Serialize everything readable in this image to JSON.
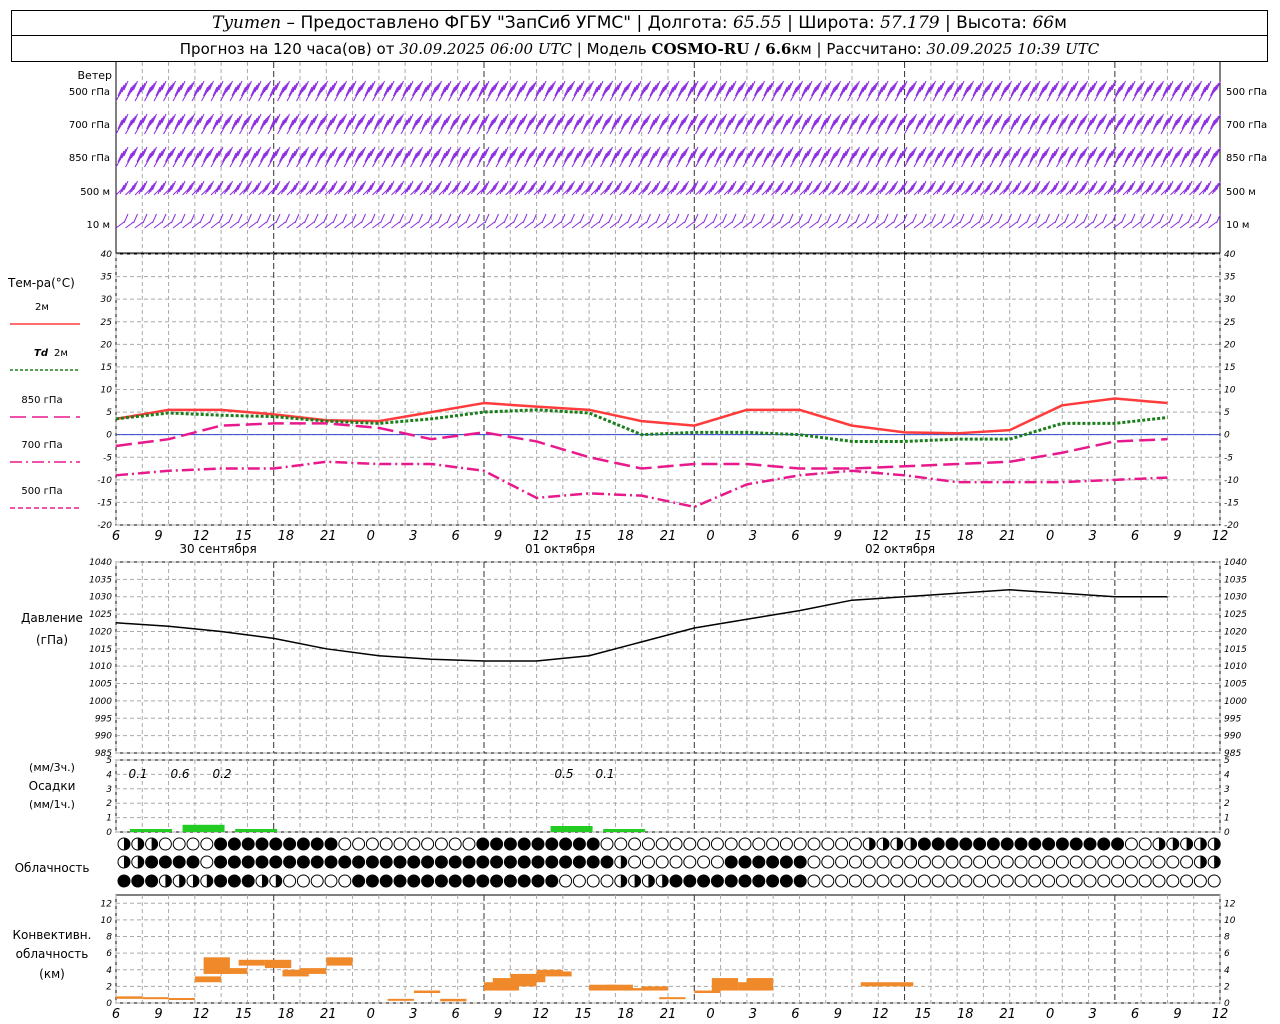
{
  "header": {
    "city": "Tyumen",
    "dash": " – ",
    "provider": "Предоставлено ФГБУ \"ЗапСиб УГМС\"",
    "lon_label": "Долгота: ",
    "lon": "65.55",
    "lat_label": "Широта: ",
    "lat": "57.179",
    "alt_label": "Высота: ",
    "alt": "66",
    "alt_unit": "м",
    "sep": " | ",
    "forecast_label": "Прогноз на 120 часа(ов) от ",
    "forecast_from": "30.09.2025 06:00 UTC",
    "model_label": "Модель ",
    "model": "COSMO-RU / 6.6",
    "model_unit": "км",
    "calc_label": "Рассчитано: ",
    "calc_time": "30.09.2025 10:39 UTC"
  },
  "panels": {
    "wind": {
      "title": "Ветер",
      "levels": [
        "500 гПа",
        "700 гПа",
        "850 гПа",
        "500 м",
        "10  м"
      ],
      "right_levels": [
        "500 гПа",
        "700 гПа",
        "850 гПа",
        "500 м",
        "10  м"
      ]
    },
    "temperature": {
      "title": "Тем-ра(°C)",
      "legend": [
        {
          "label": "2м",
          "prefix": "",
          "color": "#ff3b3b",
          "dash": ""
        },
        {
          "label": "2м",
          "prefix": "Td",
          "color": "#1a7f1a",
          "dash": "3,2"
        },
        {
          "label": "850 гПа",
          "prefix": "",
          "color": "#e8198c",
          "dash": "16,6"
        },
        {
          "label": "700 гПа",
          "prefix": "",
          "color": "#e8198c",
          "dash": "12,4,2,4"
        },
        {
          "label": "500 гПа",
          "prefix": "",
          "color": "#e8198c",
          "dash": "5,3"
        }
      ],
      "yticks": [
        "40",
        "35",
        "30",
        "25",
        "20",
        "15",
        "10",
        "5",
        "0",
        "-5",
        "-10",
        "-15",
        "-20"
      ]
    },
    "pressure": {
      "title1": "Давление",
      "title2": "(гПа)",
      "yticks": [
        "1040",
        "1035",
        "1030",
        "1025",
        "1020",
        "1015",
        "1010",
        "1005",
        "1000",
        "995",
        "990",
        "985"
      ]
    },
    "precip": {
      "title1": "(мм/3ч.)",
      "title2": "Осадки",
      "title3": "(мм/1ч.)",
      "yticks": [
        "5",
        "4",
        "3",
        "2",
        "1",
        "0"
      ],
      "labels": [
        "0.1",
        "0.6",
        "0.2",
        "0.5",
        "0.1"
      ]
    },
    "cloud": {
      "title": "Облачность"
    },
    "convective": {
      "title1": "Конвективн.",
      "title2": "облачность",
      "title3": "(км)",
      "yticks": [
        "12",
        "10",
        "8",
        "6",
        "4",
        "2",
        "0"
      ]
    }
  },
  "x_axis": {
    "ticks": [
      "6",
      "9",
      "12",
      "15",
      "18",
      "21",
      "0",
      "3",
      "6",
      "9",
      "12",
      "15",
      "18",
      "21",
      "0",
      "3",
      "6",
      "9",
      "12",
      "15",
      "18",
      "21",
      "0",
      "3",
      "6",
      "9",
      "12"
    ],
    "dates": [
      "30 сентября",
      "01 октября",
      "02 октября"
    ]
  },
  "chart_data": {
    "type": "line",
    "title": "",
    "x_hours": [
      0,
      6,
      12,
      18,
      24,
      30,
      36,
      42,
      48,
      54,
      60,
      66,
      72,
      78,
      84,
      90,
      96,
      102,
      108,
      114,
      120
    ],
    "series": [
      {
        "name": "2м",
        "values": [
          3.5,
          5.5,
          5.5,
          4.5,
          3.2,
          3.0,
          5.0,
          7.0,
          6.2,
          5.5,
          3.0,
          2.0,
          5.5,
          5.5,
          2.0,
          0.5,
          0.3,
          1.0,
          6.5,
          8.0,
          7.0
        ]
      },
      {
        "name": "Td 2м",
        "values": [
          3.5,
          4.8,
          4.3,
          4.0,
          3.0,
          2.5,
          3.5,
          5.0,
          5.5,
          4.8,
          0.0,
          0.5,
          0.5,
          0.0,
          -1.5,
          -1.5,
          -1.0,
          -1.0,
          2.5,
          2.5,
          3.8
        ]
      },
      {
        "name": "850 гПа",
        "values": [
          -2.5,
          -1.0,
          2.0,
          2.5,
          2.5,
          1.5,
          -1.0,
          0.5,
          -1.5,
          -5.0,
          -7.5,
          -6.5,
          -6.5,
          -7.5,
          -7.5,
          -7.0,
          -6.5,
          -6.0,
          -4.0,
          -1.5,
          -1.0
        ]
      },
      {
        "name": "700 гПа",
        "values": [
          -9.0,
          -8.0,
          -7.5,
          -7.5,
          -6.0,
          -6.5,
          -6.5,
          -8.0,
          -14.0,
          -13.0,
          -13.5,
          -16.0,
          -11.0,
          -9.0,
          -8.0,
          -9.0,
          -10.5,
          -10.5,
          -10.5,
          -10.0,
          -9.5
        ]
      },
      {
        "name": "Давление",
        "values": [
          1022.5,
          1021.5,
          1020,
          1018,
          1015,
          1013,
          1012,
          1011.5,
          1011.5,
          1013,
          1017,
          1021,
          1023.5,
          1026,
          1029,
          1030,
          1031,
          1032,
          1031,
          1030,
          1030
        ]
      }
    ],
    "precip_mm_3h": [
      0.1,
      0.6,
      0.2,
      0,
      0,
      0,
      0,
      0,
      0.5,
      0.1,
      0,
      0,
      0,
      0,
      0,
      0,
      0,
      0,
      0,
      0,
      0
    ],
    "temp_ylim": [
      -20,
      40
    ],
    "pressure_ylim": [
      985,
      1040
    ],
    "precip_ylim": [
      0,
      5
    ],
    "convective_ylim": [
      0,
      12
    ],
    "convective_km": [
      {
        "h": 0,
        "lo": 0.5,
        "hi": 0.8
      },
      {
        "h": 3,
        "lo": 0.5,
        "hi": 0.7
      },
      {
        "h": 6,
        "lo": 0.4,
        "hi": 0.6
      },
      {
        "h": 9,
        "lo": 2.5,
        "hi": 3.2
      },
      {
        "h": 10,
        "lo": 3.5,
        "hi": 5.5
      },
      {
        "h": 12,
        "lo": 3.5,
        "hi": 4.2
      },
      {
        "h": 14,
        "lo": 4.5,
        "hi": 5.2
      },
      {
        "h": 17,
        "lo": 4.2,
        "hi": 5.2
      },
      {
        "h": 19,
        "lo": 3.2,
        "hi": 4.0
      },
      {
        "h": 21,
        "lo": 3.5,
        "hi": 4.2
      },
      {
        "h": 24,
        "lo": 4.5,
        "hi": 5.5
      },
      {
        "h": 31,
        "lo": 0.3,
        "hi": 0.5
      },
      {
        "h": 34,
        "lo": 1.2,
        "hi": 1.5
      },
      {
        "h": 37,
        "lo": 0.2,
        "hi": 0.5
      },
      {
        "h": 42,
        "lo": 1.5,
        "hi": 2.5
      },
      {
        "h": 43,
        "lo": 1.5,
        "hi": 3.0
      },
      {
        "h": 45,
        "lo": 2.0,
        "hi": 3.5
      },
      {
        "h": 46,
        "lo": 2.5,
        "hi": 3.5
      },
      {
        "h": 48,
        "lo": 3.5,
        "hi": 4.0
      },
      {
        "h": 49,
        "lo": 3.2,
        "hi": 3.8
      },
      {
        "h": 54,
        "lo": 1.5,
        "hi": 2.2
      },
      {
        "h": 56,
        "lo": 1.5,
        "hi": 2.2
      },
      {
        "h": 58,
        "lo": 1.5,
        "hi": 1.8
      },
      {
        "h": 60,
        "lo": 1.5,
        "hi": 2.0
      },
      {
        "h": 62,
        "lo": 0.5,
        "hi": 0.7
      },
      {
        "h": 66,
        "lo": 1.2,
        "hi": 1.5
      },
      {
        "h": 68,
        "lo": 1.5,
        "hi": 3.0
      },
      {
        "h": 71,
        "lo": 1.5,
        "hi": 2.5
      },
      {
        "h": 72,
        "lo": 1.5,
        "hi": 3.0
      },
      {
        "h": 85,
        "lo": 2.0,
        "hi": 2.5
      },
      {
        "h": 88,
        "lo": 2.0,
        "hi": 2.5
      }
    ],
    "colors": {
      "t2m": "#ff3b3b",
      "td2m": "#1a7f1a",
      "t850": "#e8198c",
      "t700": "#e8198c",
      "pressure": "#000000",
      "precip": "#22cc22",
      "convective": "#f0892a",
      "wind": "#8a2be2",
      "zero_line": "#3344cc"
    }
  }
}
